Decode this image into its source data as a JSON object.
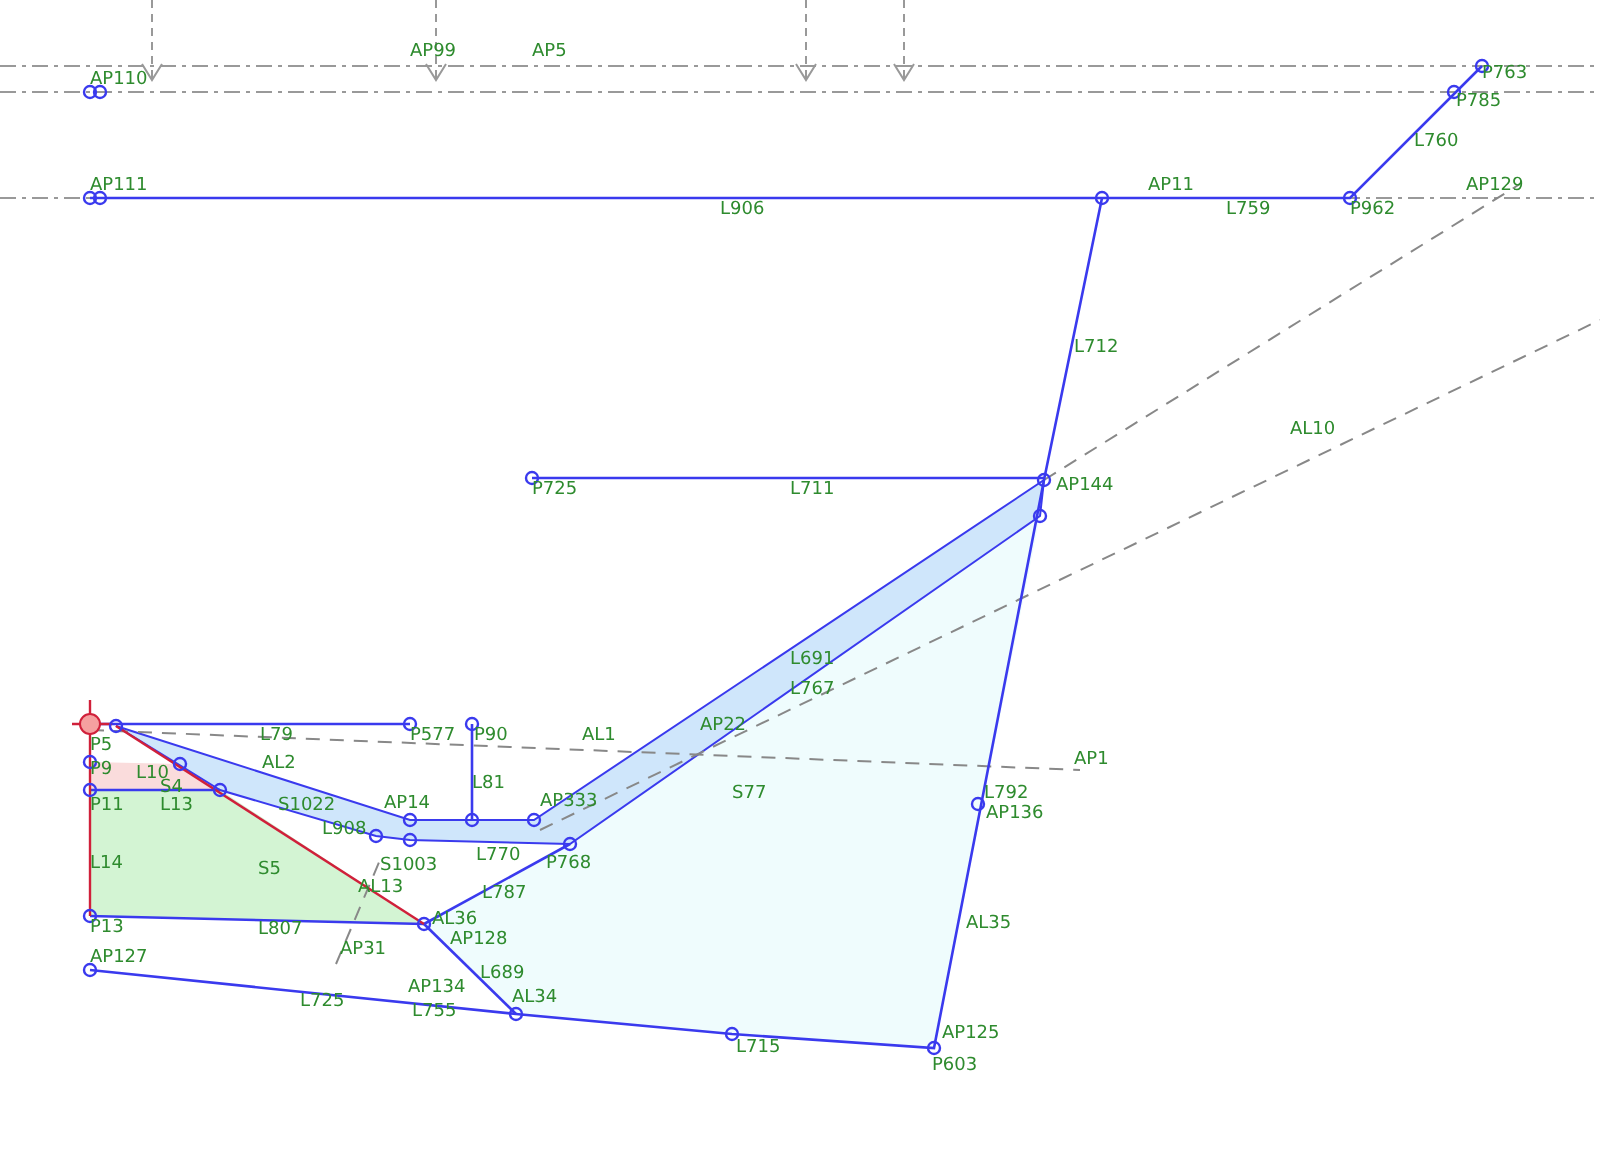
{
  "canvas": {
    "labels": [
      "AP110",
      "AP99",
      "AP5",
      "AP111",
      "L906",
      "AP11",
      "L759",
      "P962",
      "P763",
      "P785",
      "L760",
      "AP129",
      "L712",
      "AL10",
      "P725",
      "L711",
      "AP144",
      "L691",
      "L767",
      "AP22",
      "S77",
      "AL1",
      "AP1",
      "L79",
      "P577",
      "P90",
      "L81",
      "AL2",
      "P11",
      "L13",
      "L14",
      "S5",
      "P13",
      "L807",
      "AP127",
      "L725",
      "AP134",
      "L755",
      "AL34",
      "L689",
      "AL36",
      "AP128",
      "L787",
      "AL13",
      "AP31",
      "AP14",
      "AP333",
      "S1003",
      "P768",
      "S1022",
      "L792",
      "AP136",
      "AL35",
      "AP125",
      "P603",
      "L715",
      "L770",
      "P5",
      "P9",
      "L10",
      "S4",
      "L908"
    ]
  }
}
